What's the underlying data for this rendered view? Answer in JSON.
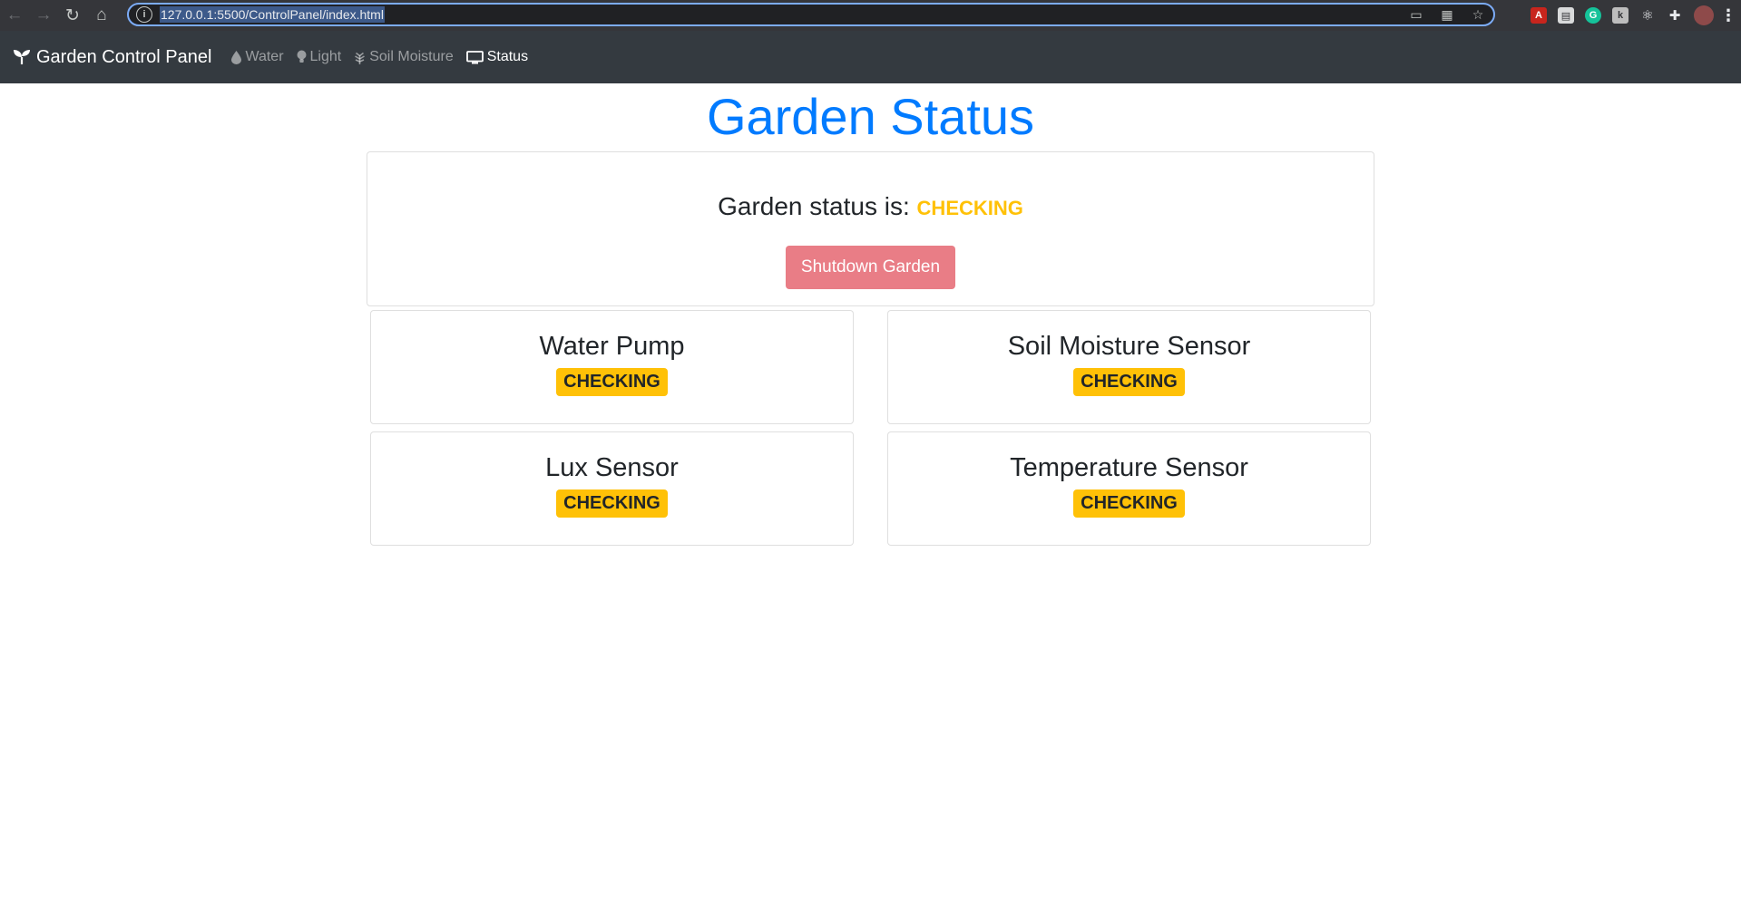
{
  "browser": {
    "url": "127.0.0.1:5500/ControlPanel/index.html",
    "nav_buttons": [
      "back-icon",
      "forward-icon",
      "reload-icon",
      "home-icon"
    ],
    "extensions": [
      "pdf-extension-icon",
      "docs-extension-icon",
      "grammarly-extension-icon",
      "k-extension-icon",
      "react-devtools-icon",
      "extensions-puzzle-icon",
      "profile-avatar",
      "chrome-menu-icon"
    ]
  },
  "navbar": {
    "brand": "Garden Control Panel",
    "links": [
      {
        "label": "Water",
        "icon": "water-drop-icon",
        "active": false
      },
      {
        "label": "Light",
        "icon": "lightbulb-icon",
        "active": false
      },
      {
        "label": "Soil Moisture",
        "icon": "seedling-icon",
        "active": false
      },
      {
        "label": "Status",
        "icon": "monitor-icon",
        "active": true
      }
    ],
    "bg_color": "#343a40"
  },
  "main": {
    "title": "Garden Status",
    "status_label": "Garden status is:",
    "status_value": "CHECKING",
    "shutdown_button": "Shutdown Garden",
    "sensors": [
      {
        "name": "Water Pump",
        "state": "CHECKING"
      },
      {
        "name": "Soil Moisture Sensor",
        "state": "CHECKING"
      },
      {
        "name": "Lux Sensor",
        "state": "CHECKING"
      },
      {
        "name": "Temperature Sensor",
        "state": "CHECKING"
      }
    ]
  },
  "colors": {
    "primary": "#007bff",
    "warning": "#ffc107",
    "danger_disabled": "#e97d86"
  }
}
